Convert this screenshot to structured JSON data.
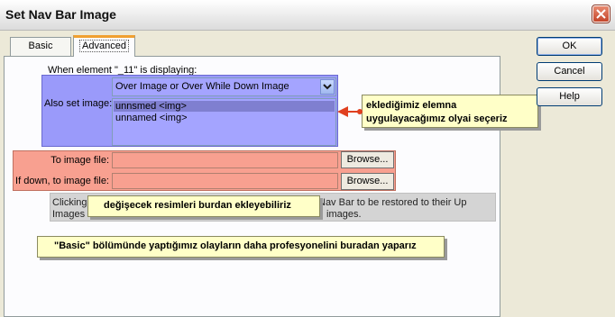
{
  "window": {
    "title": "Set Nav Bar Image"
  },
  "tabs": [
    {
      "label": "Basic"
    },
    {
      "label": "Advanced"
    }
  ],
  "advanced": {
    "when_label": "When element \"_11\" is displaying:",
    "also_set_label": "Also set image:",
    "state_select": {
      "value": "Over Image or Over While Down Image"
    },
    "image_list": [
      "unnsmed <img>",
      "unnamed <img>"
    ],
    "to_image_label": "To image file:",
    "to_image_value": "",
    "if_down_label": "If down, to image file:",
    "if_down_value": "",
    "browse_label": "Browse...",
    "note_line1_left": "Clicking",
    "note_line1_right": "Nav Bar to be restored to their Up",
    "note_line2_left": "Images",
    "note_line2_right": "images."
  },
  "buttons": {
    "ok": "OK",
    "cancel": "Cancel",
    "help": "Help"
  },
  "callouts": {
    "event": "eklediğimiz elemna uygulayacağımız olyai seçeriz",
    "images": "değişecek resimleri burdan ekleyebiliriz",
    "basic": "\"Basic\" bölümünde yaptığımız olayların daha profesyonelini buradan yaparız"
  },
  "colors": {
    "highlight_blue": "#9a9afa",
    "highlight_salmon": "#f8a090",
    "callout_yellow": "#ffffc8",
    "arrow_red": "#e04020"
  },
  "icons": {
    "close": "close-x-icon",
    "dropdown": "chevron-down-icon",
    "arrow": "left-arrow-icon"
  }
}
